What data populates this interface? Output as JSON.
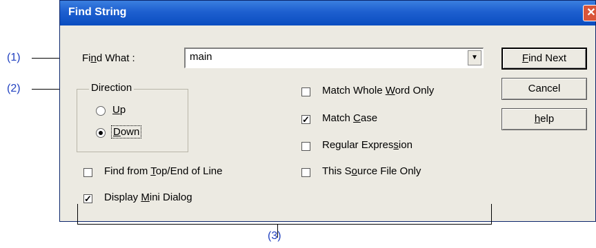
{
  "callouts": [
    "(1)",
    "(2)",
    "(3)"
  ],
  "dialog": {
    "title": "Find String",
    "close_glyph": "✕",
    "find_what_label_parts": [
      "Fi",
      "n",
      "d What :"
    ],
    "find_what_value": "main",
    "dropdown_glyph": "▼",
    "direction": {
      "legend": "Direction",
      "up_parts": [
        "",
        "U",
        "p"
      ],
      "down_parts": [
        "",
        "D",
        "own"
      ],
      "selected": "Down"
    },
    "options": [
      {
        "parts": [
          "Match Whole ",
          "W",
          "ord Only"
        ],
        "checked": false
      },
      {
        "parts": [
          "Match ",
          "C",
          "ase"
        ],
        "checked": true
      },
      {
        "parts": [
          "Regular Expres",
          "s",
          "ion"
        ],
        "checked": false
      },
      {
        "parts": [
          "This S",
          "o",
          "urce File Only"
        ],
        "checked": false
      },
      {
        "parts": [
          "Find from ",
          "T",
          "op/End of Line"
        ],
        "checked": false
      },
      {
        "parts": [
          "Display ",
          "M",
          "ini Dialog"
        ],
        "checked": true
      }
    ],
    "buttons": [
      {
        "parts": [
          "",
          "F",
          "ind Next"
        ]
      },
      {
        "parts": [
          "Cancel",
          "",
          ""
        ]
      },
      {
        "parts": [
          "",
          "h",
          "elp"
        ]
      }
    ],
    "check_glyph": "✓"
  },
  "colors": {
    "callout": "#2040c0",
    "titlebar": "#1d5fcf",
    "dialog_bg": "#eceae2"
  }
}
